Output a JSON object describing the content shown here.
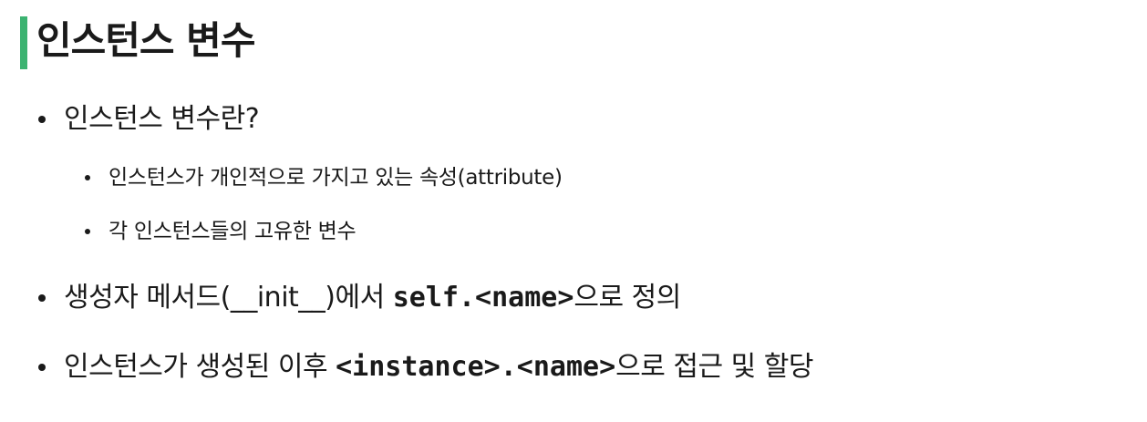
{
  "title": "인스턴스 변수",
  "colors": {
    "accent_bar": "#3cb371"
  },
  "bullets": {
    "b1": {
      "text": "인스턴스 변수란?"
    },
    "b1_sub1": {
      "text": "인스턴스가 개인적으로 가지고 있는 속성(attribute)"
    },
    "b1_sub2": {
      "text": "각 인스턴스들의 고유한 변수"
    },
    "b2": {
      "prefix": "생성자 메서드(__init__)에서 ",
      "code": "self.<name>",
      "suffix": "으로 정의"
    },
    "b3": {
      "prefix": "인스턴스가 생성된 이후 ",
      "code": "<instance>.<name>",
      "suffix": "으로 접근 및 할당"
    }
  }
}
